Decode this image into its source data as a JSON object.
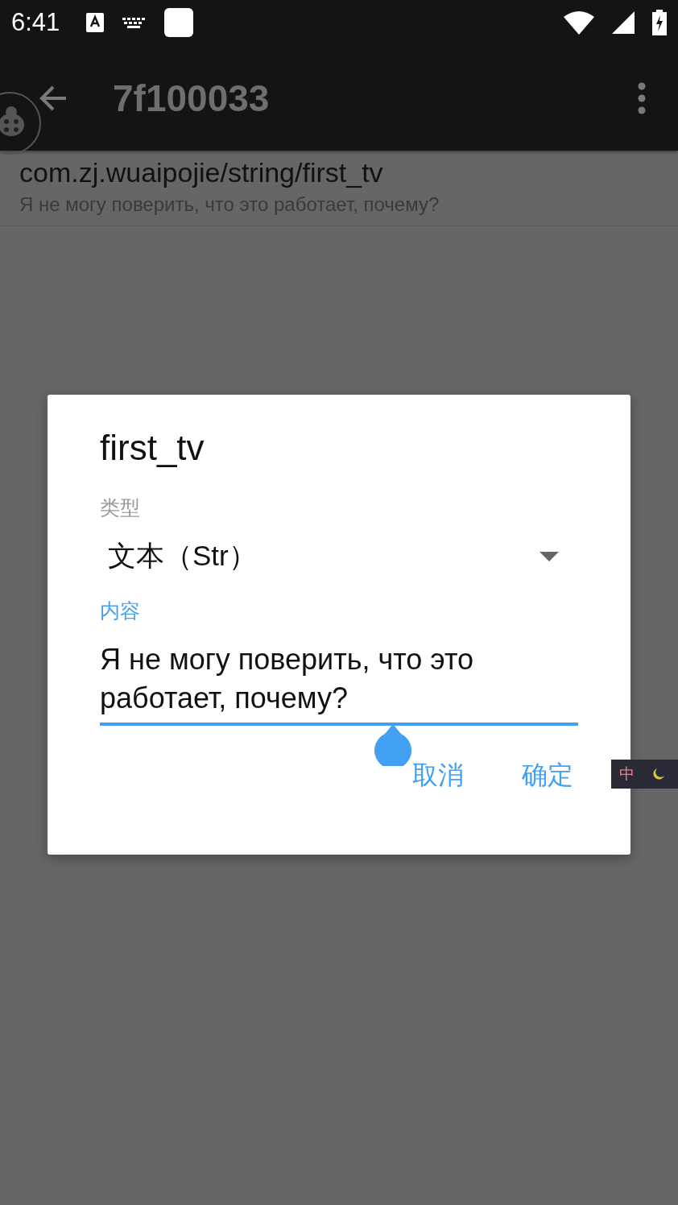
{
  "status_bar": {
    "time": "6:41"
  },
  "app_bar": {
    "title": "7f100033"
  },
  "list_item": {
    "title": "com.zj.wuaipojie/string/first_tv",
    "subtitle": "Я не могу поверить, что это работает, почему?"
  },
  "dialog": {
    "title": "first_tv",
    "type_label": "类型",
    "type_value": "文本（Str）",
    "content_label": "内容",
    "content_value": "Я не могу поверить, что это работает, почему?",
    "buttons": [
      "取消",
      "确定"
    ]
  },
  "ime_badge": {
    "label": "中"
  }
}
